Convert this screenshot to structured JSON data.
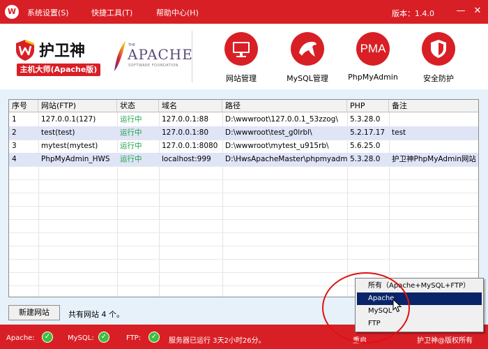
{
  "menu": {
    "app_icon": "W",
    "items": [
      "系统设置(S)",
      "快捷工具(T)",
      "帮助中心(H)"
    ],
    "version": "版本：1.4.0",
    "minimize": "—",
    "close": "✕"
  },
  "header": {
    "logo_title": "护卫神",
    "logo_subtitle": "主机大师(Apache版)",
    "apache_word": "APACHE",
    "apache_the": "THE",
    "apache_foundation": "SOFTWARE FOUNDATION",
    "tools": [
      {
        "label": "网站管理",
        "icon": "monitor-icon"
      },
      {
        "label": "MySQL管理",
        "icon": "dolphin-icon"
      },
      {
        "label": "PhpMyAdmin",
        "icon": "pma-icon",
        "icon_text": "PMA"
      },
      {
        "label": "安全防护",
        "icon": "shield-icon"
      }
    ]
  },
  "table": {
    "columns": [
      "序号",
      "网站(FTP)",
      "状态",
      "域名",
      "路径",
      "PHP",
      "备注"
    ],
    "rows": [
      {
        "no": "1",
        "site": "127.0.0.1(127)",
        "status": "运行中",
        "domain": "127.0.0.1:88",
        "path": "D:\\wwwroot\\127.0.0.1_53zzog\\",
        "php": "5.3.28.0",
        "note": ""
      },
      {
        "no": "2",
        "site": "test(test)",
        "status": "运行中",
        "domain": "127.0.0.1:80",
        "path": "D:\\wwwroot\\test_g0lrbl\\",
        "php": "5.2.17.17",
        "note": "test"
      },
      {
        "no": "3",
        "site": "mytest(mytest)",
        "status": "运行中",
        "domain": "127.0.0.1:8080",
        "path": "D:\\wwwroot\\mytest_u915rb\\",
        "php": "5.6.25.0",
        "note": ""
      },
      {
        "no": "4",
        "site": "PhpMyAdmin_HWS",
        "status": "运行中",
        "domain": "localhost:999",
        "path": "D:\\HwsApacheMaster\\phpmyadmin",
        "php": "5.3.28.0",
        "note": "护卫神PhpMyAdmin网站"
      }
    ]
  },
  "actions": {
    "new_site": "新建网站",
    "site_count": "共有网站 4 个。"
  },
  "status_bar": {
    "apache_label": "Apache:",
    "mysql_label": "MySQL:",
    "ftp_label": "FTP:",
    "check_glyph": "✓",
    "uptime": "服务器已运行 3天2小时26分。",
    "restart": "重启",
    "copyright": "护卫神@版权所有"
  },
  "popup": {
    "items": [
      "所有（Apache+MySQL+FTP）",
      "Apache",
      "MySQL",
      "FTP"
    ],
    "selected_index": 1
  },
  "colors": {
    "brand_red": "#d91f26",
    "status_green": "#1aa346",
    "selection_blue": "#0a246a",
    "row_alt": "#dfe4f7"
  }
}
